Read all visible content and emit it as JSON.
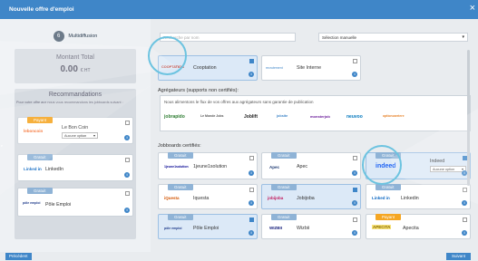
{
  "header": {
    "title": "Nouvelle offre d'emploi",
    "close": "×"
  },
  "step": {
    "number": "6",
    "label": "Multidiffusion"
  },
  "total": {
    "title": "Montant Total",
    "amount": "0.00",
    "currency": "€ HT"
  },
  "recommendations": {
    "title": "Recommandations",
    "description": "Pour votre offre aux nous vous recommandons les jobboards suivant :",
    "cards": [
      {
        "badge": "Payant",
        "badge_color": "orange",
        "name": "Le Bon Coin",
        "logo": "leboncoin",
        "select": "Aucune option",
        "checked": false
      },
      {
        "badge": "Gratuit",
        "badge_color": "blue",
        "name": "LinkedIn",
        "logo": "Linked in",
        "checked": false
      },
      {
        "badge": "Gratuit",
        "badge_color": "blue",
        "name": "Pôle Emploi",
        "logo": "pôle emploi",
        "checked": false
      }
    ]
  },
  "search": {
    "placeholder": "Recherche par nom"
  },
  "sort": {
    "value": "Sélection manuelle",
    "arrow": "▾"
  },
  "top_cards": [
    {
      "name": "Cooptation",
      "logo": "COOPTATION",
      "checked": true,
      "selected": true
    },
    {
      "name": "Site Interne",
      "logo": "recrutement",
      "checked": false,
      "selected": false
    }
  ],
  "aggregators": {
    "title": "Agrégateurs (supports non certifiés):",
    "description": "Nous alimentons le flux de vos offres aux agrégateurs sans garantie de publication",
    "logos": [
      "jobrapido",
      "Le Monde Jobs",
      "Joblift",
      "jobsite",
      "monsterjob",
      "neuvoo",
      "optioncarriere"
    ]
  },
  "jobboards": {
    "title": "Jobboards certifiés:",
    "cards": [
      {
        "badge": "Gratuit",
        "name": "1jeune1solution",
        "logo": "1jeune1solution",
        "checked": false,
        "selected": false
      },
      {
        "badge": "Gratuit",
        "name": "Apec",
        "logo": "Apec",
        "checked": false,
        "selected": false
      },
      {
        "badge": "Gratuit",
        "name": "Indeed",
        "logo": "indeed",
        "select": "Aucune option",
        "checked": true,
        "selected": true
      },
      {
        "badge": "Gratuit",
        "name": "Iquesta",
        "logo": "iQuesta",
        "checked": false,
        "selected": false
      },
      {
        "badge": "Gratuit",
        "name": "Jobijoba",
        "logo": "jobijoba",
        "checked": true,
        "selected": true
      },
      {
        "badge": "Gratuit",
        "name": "Linkedin",
        "logo": "Linked in",
        "checked": false,
        "selected": false
      },
      {
        "badge": "Gratuit",
        "name": "Pôle Emploi",
        "logo": "pôle emploi",
        "checked": true,
        "selected": true
      },
      {
        "badge": "Gratuit",
        "name": "Wizbii",
        "logo": "WIZBII",
        "checked": false,
        "selected": false
      },
      {
        "badge": "Payant",
        "name": "Apecita",
        "logo": "APECITA",
        "checked": false,
        "selected": false
      }
    ]
  },
  "footer": {
    "prev": "Précédent",
    "next": "Suivant"
  },
  "side_label": "e",
  "info_icon": "i"
}
